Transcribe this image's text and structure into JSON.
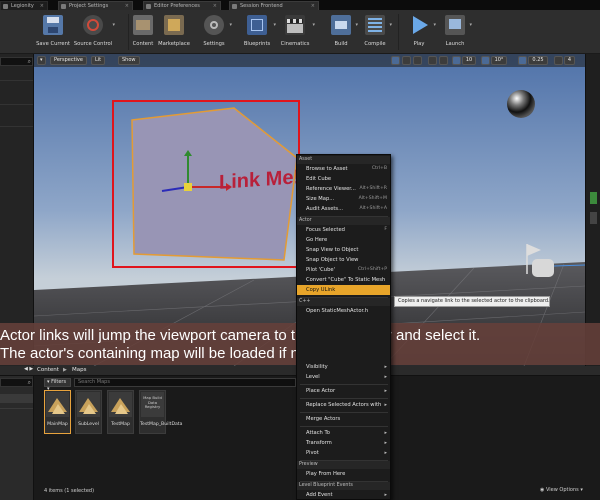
{
  "tabs": [
    {
      "label": "Legionity",
      "icon": "level-icon"
    },
    {
      "label": "Project Settings",
      "icon": "settings-icon"
    },
    {
      "label": "Editor Preferences",
      "icon": "settings-icon"
    },
    {
      "label": "Session Frontend",
      "icon": "session-icon"
    }
  ],
  "toolbar": {
    "save_current": "Save Current",
    "source_control": "Source Control",
    "content": "Content",
    "marketplace": "Marketplace",
    "settings": "Settings",
    "blueprints": "Blueprints",
    "cinematics": "Cinematics",
    "build": "Build",
    "compile": "Compile",
    "play": "Play",
    "launch": "Launch"
  },
  "viewport": {
    "perspective": "Perspective",
    "lit": "Lit",
    "show": "Show",
    "grid_snap": "10",
    "rotation_snap": "10°",
    "scale_snap": "0.25",
    "camera_speed": "4",
    "link_text": "Link Me!"
  },
  "context_menu": {
    "header_asset": "Asset",
    "browse": "Browse to Asset",
    "browse_sc": "Ctrl+B",
    "edit_cube": "Edit Cube",
    "ref_viewer": "Reference Viewer...",
    "ref_viewer_sc": "Alt+Shift+R",
    "size_map": "Size Map...",
    "size_map_sc": "Alt+Shift+M",
    "audit": "Audit Assets...",
    "audit_sc": "Alt+Shift+A",
    "header_actor": "Actor",
    "focus": "Focus Selected",
    "focus_sc": "F",
    "go_here": "Go Here",
    "snap_view": "Snap View to Object",
    "snap_object": "Snap Object to View",
    "pilot": "Pilot 'Cube'",
    "pilot_sc": "Ctrl+Shift+P",
    "convert": "Convert \"Cube\" To Static Mesh",
    "copy_link": "Copy ULink",
    "header_cpp": "C++",
    "open_cpp": "Open StaticMeshActor.h",
    "visibility": "Visibility",
    "level": "Level",
    "place_actor": "Place Actor",
    "replace": "Replace Selected Actors with",
    "merge": "Merge Actors",
    "attach": "Attach To",
    "transform": "Transform",
    "pivot": "Pivot",
    "header_preview": "Preview",
    "play_from_here": "Play From Here",
    "header_level_bp": "Level Blueprint Events",
    "add_event": "Add Event"
  },
  "tooltip": "Copies a navigate link to the selected actor to the clipboard.",
  "caption": {
    "line1": "Actor links will jump the viewport camera to the target actor and select it.",
    "line2": "The actor's containing map will be loaded if necessary."
  },
  "content_browser": {
    "path_root": "Content",
    "path_sub": "Maps",
    "filters": "Filters",
    "search_placeholder": "Search Maps",
    "assets": [
      {
        "name": "MainMap"
      },
      {
        "name": "SubLevel"
      },
      {
        "name": "TestMap"
      },
      {
        "name": "TestMap_BuiltData"
      }
    ],
    "assets_built_label": "Map Build Data Registry",
    "status": "4 items (1 selected)",
    "view_options": "View Options"
  },
  "colors": {
    "accent": "#e8a52a",
    "selection_box": "#e0141c",
    "caption_bg": "#65403a"
  }
}
